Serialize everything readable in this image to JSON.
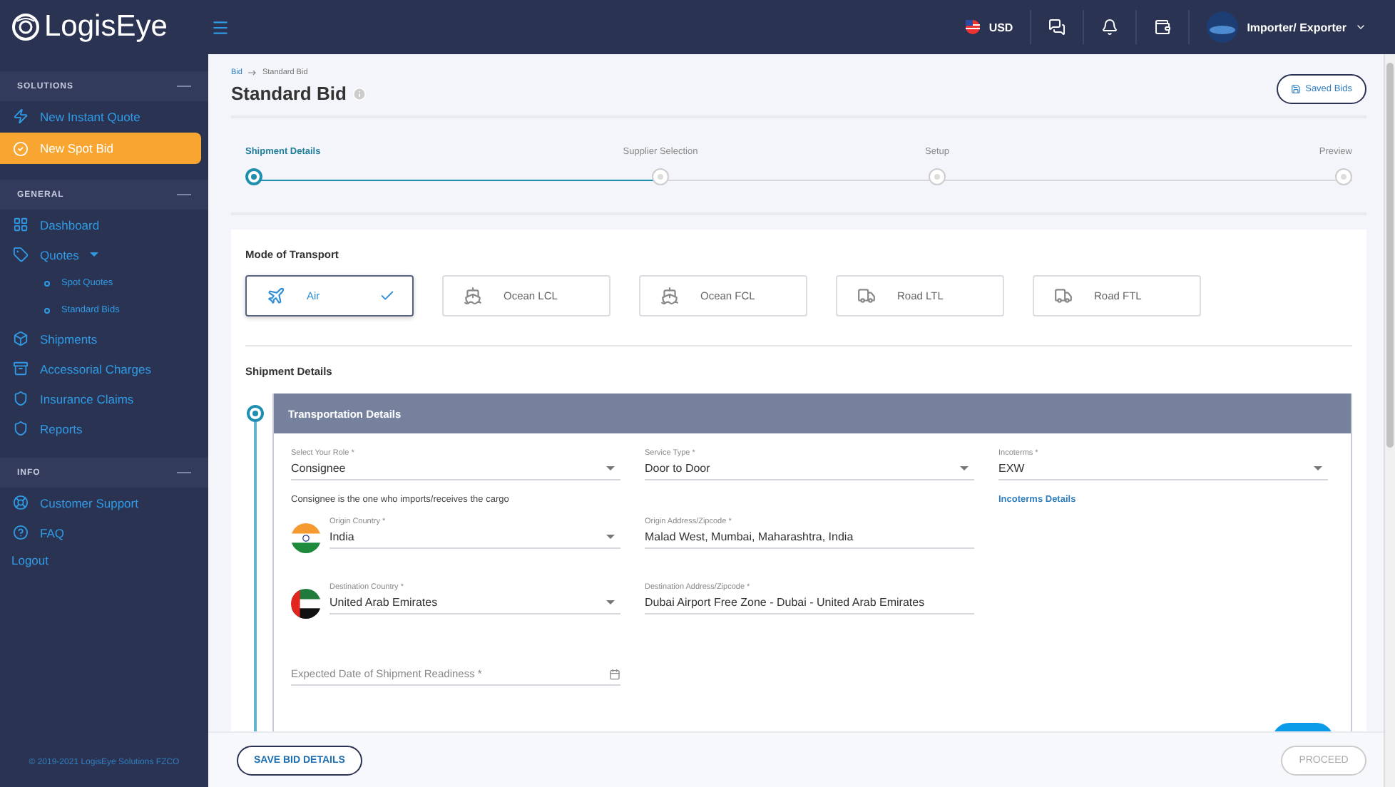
{
  "topbar": {
    "logo": "LogisEye",
    "currency": "USD",
    "user": "Importer/ Exporter"
  },
  "sidebar": {
    "sections": [
      {
        "title": "SOLUTIONS",
        "items": [
          {
            "label": "New Instant Quote",
            "selected": false
          },
          {
            "label": "New Spot Bid",
            "selected": true
          }
        ]
      },
      {
        "title": "GENERAL",
        "items": [
          {
            "label": "Dashboard",
            "selected": false
          },
          {
            "label": "Quotes",
            "selected": false,
            "expanded": true,
            "children": [
              {
                "label": "Spot Quotes"
              },
              {
                "label": "Standard Bids"
              }
            ]
          },
          {
            "label": "Shipments",
            "selected": false
          },
          {
            "label": "Accessorial Charges",
            "selected": false
          },
          {
            "label": "Insurance Claims",
            "selected": false
          },
          {
            "label": "Reports",
            "selected": false
          }
        ]
      },
      {
        "title": "INFO",
        "items": [
          {
            "label": "Customer Support",
            "selected": false
          },
          {
            "label": "FAQ",
            "selected": false
          }
        ]
      }
    ],
    "logout": "Logout",
    "copyright": "© 2019-2021 LogisEye Solutions FZCO"
  },
  "page": {
    "breadcrumb": [
      "Bid",
      "Standard Bid"
    ],
    "title": "Standard Bid",
    "saved_bids": "Saved Bids"
  },
  "stepper": [
    {
      "label": "Shipment Details",
      "selected": true
    },
    {
      "label": "Supplier Selection",
      "selected": false
    },
    {
      "label": "Setup",
      "selected": false
    },
    {
      "label": "Preview",
      "selected": false
    }
  ],
  "mode": {
    "title": "Mode of Transport",
    "options": [
      {
        "label": "Air",
        "kind": "air",
        "selected": true
      },
      {
        "label": "Ocean LCL",
        "kind": "ship",
        "selected": false
      },
      {
        "label": "Ocean FCL",
        "kind": "ship",
        "selected": false
      },
      {
        "label": "Road LTL",
        "kind": "truck",
        "selected": false
      },
      {
        "label": "Road FTL",
        "kind": "truck",
        "selected": false
      }
    ]
  },
  "shipment": {
    "title": "Shipment Details",
    "panel_title": "Transportation Details",
    "rows": [
      [
        {
          "kind": "select",
          "label": "Select Your Role *",
          "value": "Consignee"
        },
        {
          "kind": "select",
          "label": "Service Type *",
          "value": "Door to Door"
        },
        {
          "kind": "select",
          "label": "Incoterms *",
          "value": "EXW"
        }
      ],
      [
        {
          "kind": "note",
          "text": "Consignee is the one who imports/receives the cargo"
        },
        {
          "kind": "empty"
        },
        {
          "kind": "link",
          "text": "Incoterms Details"
        }
      ],
      [
        {
          "kind": "country",
          "label": "Origin Country *",
          "value": "India"
        },
        {
          "kind": "text",
          "label": "Origin Address/Zipcode *",
          "value": "Malad West, Mumbai, Maharashtra, India"
        },
        {
          "kind": "empty"
        }
      ],
      [
        {
          "kind": "country",
          "label": "Destination Country *",
          "value": "United Arab Emirates"
        },
        {
          "kind": "text",
          "label": "Destination Address/Zipcode *",
          "value": "Dubai Airport Free Zone - Dubai - United Arab Emirates"
        },
        {
          "kind": "empty"
        }
      ],
      [
        {
          "kind": "date",
          "placeholder": "Expected Date of Shipment Readiness *"
        },
        {
          "kind": "empty"
        },
        {
          "kind": "empty"
        }
      ]
    ]
  },
  "footer": {
    "save": "SAVE BID DETAILS",
    "proceed": {
      "label": "PROCEED",
      "disabled": true
    }
  }
}
